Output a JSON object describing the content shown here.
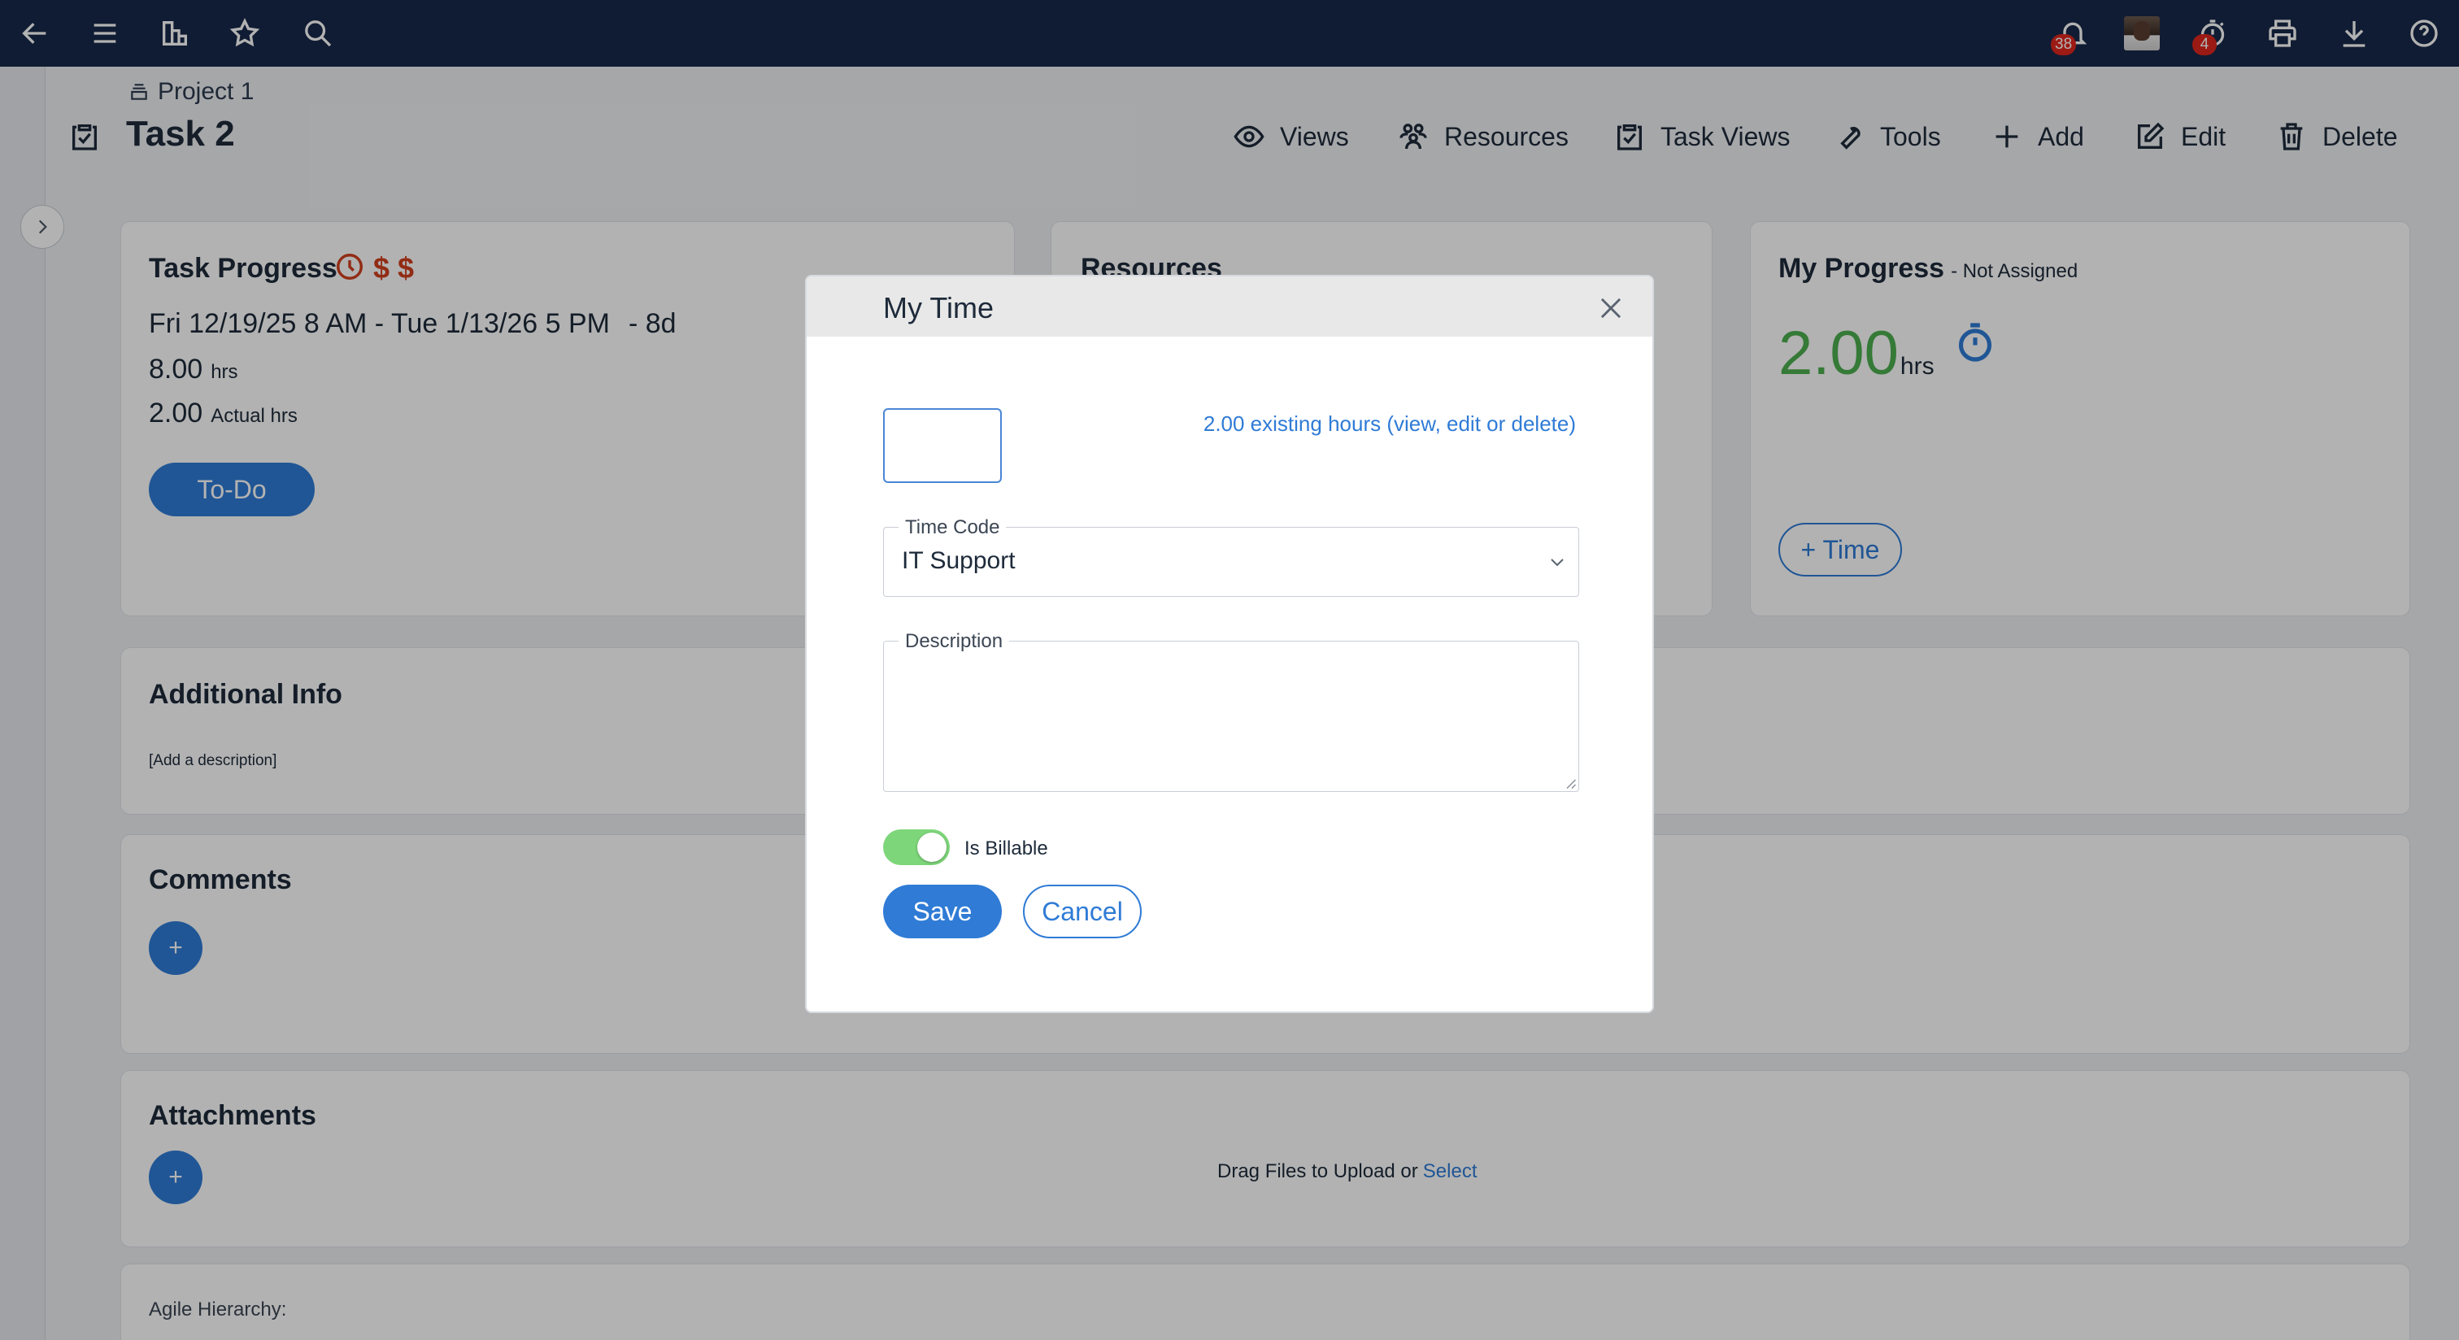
{
  "topbar": {
    "icons": [
      "back-arrow-icon",
      "hamburger-menu-icon",
      "building-icon",
      "star-icon",
      "search-icon",
      "bell-icon",
      "avatar",
      "stopwatch-icon",
      "printer-icon",
      "download-icon",
      "help-icon"
    ],
    "notifications_count": "38",
    "timers_count": "4"
  },
  "header": {
    "breadcrumb": "Project 1",
    "title": "Task 2",
    "actions": [
      "Views",
      "Resources",
      "Task Views",
      "Tools",
      "Add",
      "Edit",
      "Delete"
    ]
  },
  "task_progress": {
    "title": "Task Progress",
    "date_range": "Fri 12/19/25 8 AM - Tue 1/13/26 5 PM",
    "duration": "- 8d",
    "planned_hours": "8.00",
    "planned_unit": "hrs",
    "actual_hours": "2.00",
    "actual_unit": "Actual hrs",
    "status_button": "To-Do",
    "status_icons_color": "#d2401f"
  },
  "resources": {
    "title": "Resources"
  },
  "my_progress": {
    "title": "My Progress",
    "subtitle": "- Not Assigned",
    "hours": "2.00",
    "hours_unit": "hrs",
    "add_time_button": "+ Time",
    "hours_color": "#4caf50"
  },
  "additional_info": {
    "title": "Additional Info",
    "placeholder": "[Add a description]"
  },
  "comments": {
    "title": "Comments",
    "add_button": "+"
  },
  "attachments": {
    "title": "Attachments",
    "add_button": "+",
    "drag_text": "Drag Files to Upload or",
    "select_link": "Select"
  },
  "agile": {
    "label": "Agile Hierarchy:"
  },
  "modal": {
    "title": "My Time",
    "hours_value": "",
    "existing_link": "2.00 existing hours (view, edit or delete)",
    "time_code_label": "Time Code",
    "time_code_value": "IT Support",
    "description_label": "Description",
    "description_value": "",
    "billable_label": "Is Billable",
    "billable_on": true,
    "save_button": "Save",
    "cancel_button": "Cancel"
  },
  "colors": {
    "navbar": "#17294a",
    "accent": "#2f7bd6",
    "danger_badge": "#e0261d",
    "toggle_on": "#7ed67a"
  }
}
